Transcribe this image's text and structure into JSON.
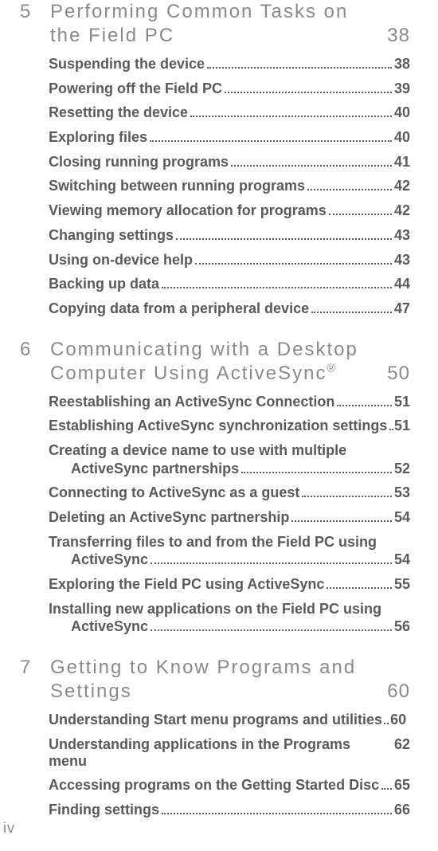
{
  "page_number": "iv",
  "chapters": [
    {
      "num": "5",
      "title": "Performing Common Tasks on the Field PC",
      "page": "38",
      "entries": [
        {
          "label": "Suspending the device",
          "page": "38"
        },
        {
          "label": "Powering off the Field PC",
          "page": "39"
        },
        {
          "label": "Resetting the device",
          "page": "40"
        },
        {
          "label": "Exploring files",
          "page": "40"
        },
        {
          "label": "Closing running programs",
          "page": "41"
        },
        {
          "label": "Switching between running programs",
          "page": "42"
        },
        {
          "label": "Viewing memory allocation for programs",
          "page": "42"
        },
        {
          "label": "Changing settings",
          "page": "43"
        },
        {
          "label": "Using on-device help",
          "page": "43"
        },
        {
          "label": "Backing up data",
          "page": "44"
        },
        {
          "label": "Copying data from a peripheral device",
          "page": "47"
        }
      ]
    },
    {
      "num": "6",
      "title_html": "Communicating with a Desktop Computer Using ActiveSync<sup>®</sup>",
      "page": "50",
      "entries": [
        {
          "label": "Reestablishing an ActiveSync Connection",
          "page": "51"
        },
        {
          "label": "Establishing ActiveSync synchronization settings",
          "page": "51"
        },
        {
          "wrap_first": "Creating a device name to use with multiple",
          "wrap_second": "ActiveSync partnerships",
          "page": "52"
        },
        {
          "label": "Connecting to ActiveSync as a guest",
          "page": "53"
        },
        {
          "label": "Deleting an ActiveSync partnership",
          "page": "54"
        },
        {
          "wrap_first": "Transferring files to and from the Field PC using",
          "wrap_second": "ActiveSync",
          "page": "54"
        },
        {
          "label": "Exploring the Field PC using ActiveSync",
          "page": "55"
        },
        {
          "wrap_first": "Installing new applications on the Field PC using",
          "wrap_second": "ActiveSync",
          "page": "56"
        }
      ]
    },
    {
      "num": "7",
      "title": "Getting to Know Programs and Settings",
      "page": "60",
      "entries": [
        {
          "label": "Understanding Start menu programs and utilities",
          "page": "60",
          "no_leader": true
        },
        {
          "label": "Understanding applications in the Programs menu",
          "page": "62",
          "no_leader": true,
          "space": true
        },
        {
          "label": "Accessing programs on the Getting Started Disc",
          "page": "65"
        },
        {
          "label": "Finding settings",
          "page": "66"
        }
      ]
    }
  ]
}
